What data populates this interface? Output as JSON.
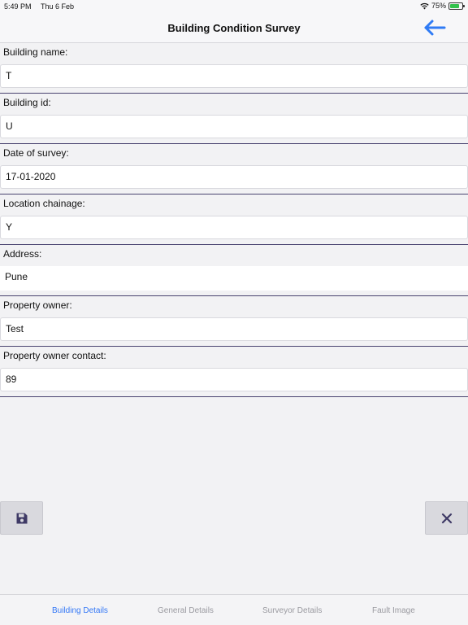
{
  "status_bar": {
    "time": "5:49 PM",
    "date": "Thu 6 Feb",
    "battery": "75%"
  },
  "nav": {
    "title": "Building Condition Survey",
    "back_icon": "arrow-left-icon",
    "accent_color": "#2f7bf5"
  },
  "form": {
    "fields": [
      {
        "label": "Building name:",
        "value": "T"
      },
      {
        "label": "Building id:",
        "value": "U"
      },
      {
        "label": "Date of survey:",
        "value": "17-01-2020"
      },
      {
        "label": "Location chainage:",
        "value": "Y"
      },
      {
        "label": "Address:",
        "value": "Pune"
      },
      {
        "label": "Property owner:",
        "value": "Test"
      },
      {
        "label": "Property owner contact:",
        "value": "89"
      }
    ]
  },
  "actions": {
    "save_icon": "floppy-disk-icon",
    "close_icon": "close-icon"
  },
  "tabs": [
    {
      "label": "Building Details",
      "active": true
    },
    {
      "label": "General Details",
      "active": false
    },
    {
      "label": "Surveyor Details",
      "active": false
    },
    {
      "label": "Fault Image",
      "active": false
    }
  ]
}
